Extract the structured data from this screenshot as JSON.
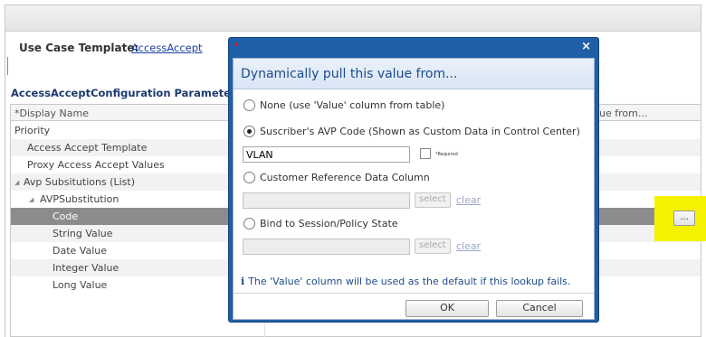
{
  "page": {
    "use_case_label": "Use Case Template:",
    "use_case_link": "AccessAccept",
    "params_title": "AccessAcceptConfiguration Parameters"
  },
  "tree": {
    "col1_header": "*Display Name",
    "col2_header": "ue from...",
    "rows": [
      {
        "label": "Priority",
        "depth": 1
      },
      {
        "label": "Access Accept Template",
        "depth": 1
      },
      {
        "label": "Proxy Access Accept Values",
        "depth": 1
      },
      {
        "label": "Avp Subsitutions (List)",
        "depth": 0
      },
      {
        "label": "AVPSubstitution",
        "depth": 1
      },
      {
        "label": "Code",
        "depth": 2,
        "selected": true
      },
      {
        "label": "String Value",
        "depth": 2
      },
      {
        "label": "Date Value",
        "depth": 2
      },
      {
        "label": "Integer Value",
        "depth": 2
      },
      {
        "label": "Long Value",
        "depth": 2
      }
    ],
    "expand_glyph": "◢",
    "dots_button": "..."
  },
  "dialog": {
    "close_glyph": "×",
    "heading": "Dynamically pull this value from...",
    "opt_none": "None (use 'Value' column from table)",
    "opt_avp": "Suscriber's AVP Code (Shown as Custom Data in Control Center)",
    "avp_value": "VLAN",
    "required_label": "*Required",
    "opt_customer": "Customer Reference Data Column",
    "opt_session": "Bind to Session/Policy State",
    "select_label": "select",
    "clear_label": "clear",
    "info_icon": "i",
    "info_text": "The 'Value' column will be used as the default if this lookup fails.",
    "ok_label": "OK",
    "cancel_label": "Cancel",
    "selected_option": "avp"
  },
  "colors": {
    "dialog_frame": "#1f5fa8",
    "heading_text": "#1d4b8a",
    "selected_row": "#8c8c8c",
    "note_highlight": "#f4f200"
  }
}
